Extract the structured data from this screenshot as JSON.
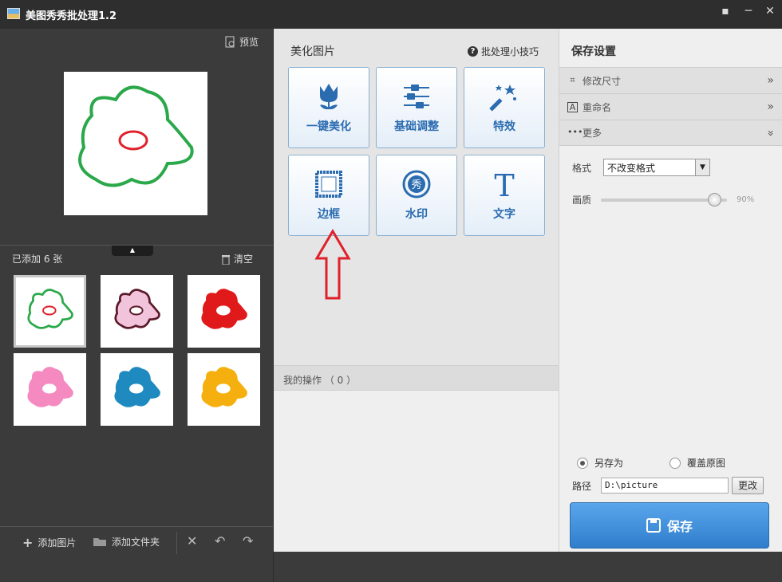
{
  "window": {
    "title": "美图秀秀批处理1.2",
    "feedback_icon": "chat-icon",
    "minimize": "─",
    "close": "✕"
  },
  "left": {
    "preview_label": "预览",
    "added_label": "已添加 6 张",
    "clear_label": "清空",
    "thumbnails": [
      {
        "fill": "#ffffff",
        "stroke": "#2aa84a",
        "center_fill": "#ffffff",
        "center_stroke": "#e0202a"
      },
      {
        "fill": "#f2c4dc",
        "stroke": "#5a1a2a",
        "center_fill": "#ffffff",
        "center_stroke": "#5a1a2a"
      },
      {
        "fill": "#e01a1a",
        "stroke": "#e01a1a",
        "center_fill": "#ffffff",
        "center_stroke": "#ffffff"
      },
      {
        "fill": "#f58ac0",
        "stroke": "#f58ac0",
        "center_fill": "#ffffff",
        "center_stroke": "#ffffff"
      },
      {
        "fill": "#1f8ac0",
        "stroke": "#1f8ac0",
        "center_fill": "#ffffff",
        "center_stroke": "#ffffff"
      },
      {
        "fill": "#f5b010",
        "stroke": "#f5b010",
        "center_fill": "#ffffff",
        "center_stroke": "#ffffff"
      }
    ],
    "footer": {
      "add_image": "添加图片",
      "add_folder": "添加文件夹"
    }
  },
  "center": {
    "heading": "美化图片",
    "tips_label": "批处理小技巧",
    "tools": [
      {
        "label": "一键美化",
        "icon": "tulip-icon"
      },
      {
        "label": "基础调整",
        "icon": "sliders-icon"
      },
      {
        "label": "特效",
        "icon": "magic-wand-icon"
      },
      {
        "label": "边框",
        "icon": "frame-icon"
      },
      {
        "label": "水印",
        "icon": "watermark-icon"
      },
      {
        "label": "文字",
        "icon": "text-icon"
      }
    ],
    "ops_label": "我的操作 （ 0 ）"
  },
  "right": {
    "heading": "保存设置",
    "accordion": [
      {
        "label": "修改尺寸",
        "icon": "crop-icon"
      },
      {
        "label": "重命名",
        "icon": "rename-icon"
      },
      {
        "label": "更多",
        "icon": "more-icon"
      }
    ],
    "format_label": "格式",
    "format_value": "不改变格式",
    "quality_label": "画质",
    "quality_value": "90%",
    "quality_fraction": 0.9,
    "save_as_label": "另存为",
    "overwrite_label": "覆盖原图",
    "path_label": "路径",
    "path_value": "D:\\picture",
    "change_label": "更改",
    "save_label": "保存"
  },
  "colors": {
    "accent_blue": "#2b6cb0",
    "annotation_red": "#e0202a"
  }
}
